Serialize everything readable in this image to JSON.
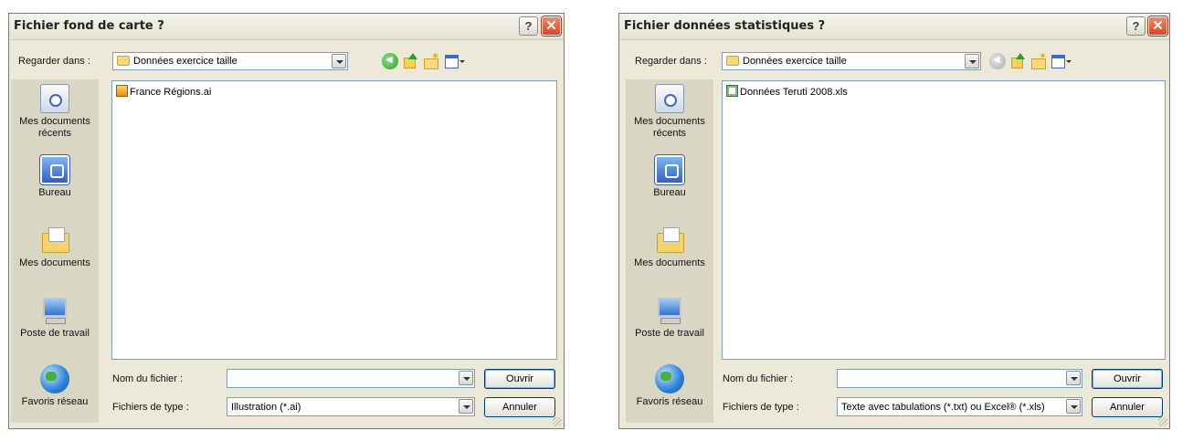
{
  "dialogs": [
    {
      "title": "Fichier fond de carte ?",
      "look_in_label": "Regarder dans :",
      "look_in_value": "Données exercice taille",
      "back_enabled": true,
      "places": [
        "Mes documents récents",
        "Bureau",
        "Mes documents",
        "Poste de travail",
        "Favoris réseau"
      ],
      "files": [
        {
          "name": "France Régions.ai",
          "icon": "illustrator-file-icon"
        }
      ],
      "file_name_label": "Nom du fichier :",
      "file_name_value": "",
      "file_type_label": "Fichiers de type :",
      "file_type_value": "Illustration (*.ai)",
      "open_label": "Ouvrir",
      "cancel_label": "Annuler",
      "help_glyph": "?",
      "close_glyph": "✕"
    },
    {
      "title": "Fichier données statistiques ?",
      "look_in_label": "Regarder dans :",
      "look_in_value": "Données exercice taille",
      "back_enabled": false,
      "places": [
        "Mes documents récents",
        "Bureau",
        "Mes documents",
        "Poste de travail",
        "Favoris réseau"
      ],
      "files": [
        {
          "name": "Données Teruti 2008.xls",
          "icon": "excel-file-icon"
        }
      ],
      "file_name_label": "Nom du fichier :",
      "file_name_value": "",
      "file_type_label": "Fichiers de type :",
      "file_type_value": "Texte avec tabulations (*.txt) ou Excel® (*.xls)",
      "open_label": "Ouvrir",
      "cancel_label": "Annuler",
      "help_glyph": "?",
      "close_glyph": "✕"
    }
  ],
  "colors": {
    "dialog_background": "#ece9d8",
    "places_background": "#d9d6c4",
    "field_border": "#7f9db9",
    "close_button": "#d9442a"
  }
}
